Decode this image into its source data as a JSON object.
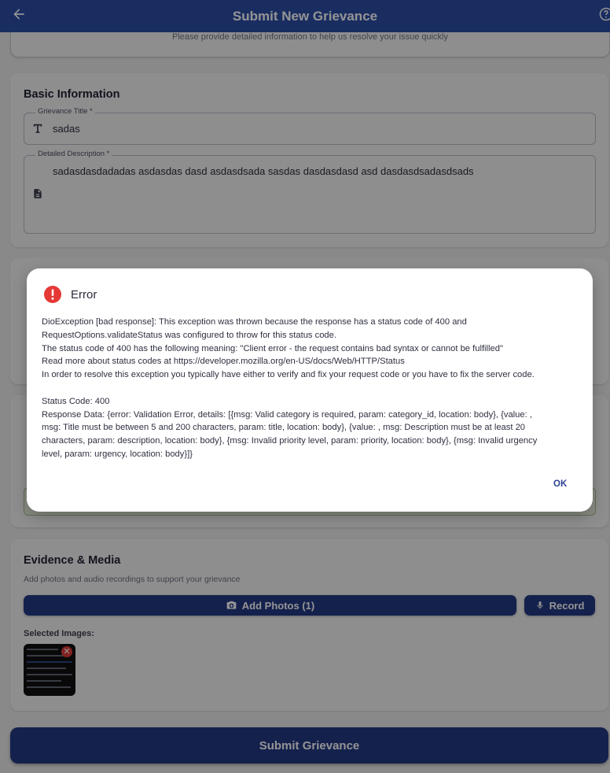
{
  "app_bar": {
    "title": "Submit New Grievance",
    "back_icon": "arrow-left-icon",
    "help_icon": "help-circle-icon"
  },
  "intro": {
    "subtitle": "Please provide detailed information to help us resolve your issue quickly"
  },
  "basic_info": {
    "title": "Basic Information",
    "title_field": {
      "label": "Grievance Title *",
      "value": "sadas",
      "icon": "text-title-icon"
    },
    "description_field": {
      "label": "Detailed Description *",
      "value": "sadasdasdadadas asdasdas dasd asdasdsada sasdas dasdasdasd asd dasdasdsadasdsads",
      "icon": "document-icon"
    }
  },
  "evidence": {
    "title": "Evidence & Media",
    "subtitle": "Add photos and audio recordings to support your grievance",
    "add_photos_label": "Add Photos (1)",
    "record_label": "Record",
    "selected_images_label": "Selected Images:"
  },
  "submit_label": "Submit Grievance",
  "dialog": {
    "title": "Error",
    "lines": [
      "DioException [bad response]: This exception was thrown because the response has a status code of 400 and",
      "RequestOptions.validateStatus was configured to throw for this status code.",
      "The status code of 400 has the following meaning: \"Client error - the request contains bad syntax or cannot be fulfilled\"",
      "Read more about status codes at https://developer.mozilla.org/en-US/docs/Web/HTTP/Status",
      "In order to resolve this exception you typically have either to verify and fix your request code or you have to fix the server code.",
      "",
      "Status Code: 400",
      "Response Data: {error: Validation Error, details: [{msg: Valid category is required, param: category_id, location: body}, {value: ,",
      "msg: Title must be between 5 and 200 characters, param: title, location: body}, {value: , msg: Description must be at least 20",
      "characters, param: description, location: body}, {msg: Invalid priority level, param: priority, location: body}, {msg: Invalid urgency",
      "level, param: urgency, location: body}]}"
    ],
    "ok_label": "OK"
  },
  "colors": {
    "primary": "#243a85",
    "error": "#e53935"
  }
}
